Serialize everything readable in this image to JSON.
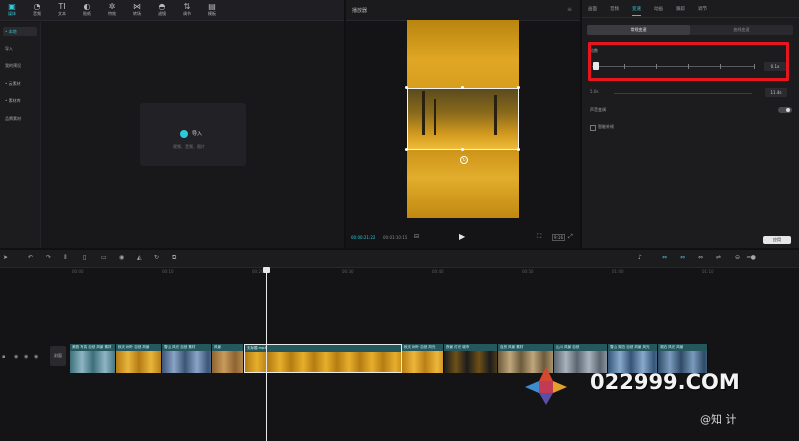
{
  "media_panel": {
    "toolbar": [
      {
        "label": "媒体",
        "icon": "media-icon",
        "glyph": "▣"
      },
      {
        "label": "音频",
        "icon": "audio-icon",
        "glyph": "◔"
      },
      {
        "label": "文本",
        "icon": "text-icon",
        "glyph": "TI"
      },
      {
        "label": "贴纸",
        "icon": "sticker-icon",
        "glyph": "◐"
      },
      {
        "label": "特效",
        "icon": "effects-icon",
        "glyph": "✲"
      },
      {
        "label": "转场",
        "icon": "transition-icon",
        "glyph": "⋈"
      },
      {
        "label": "滤镜",
        "icon": "filter-icon",
        "glyph": "◓"
      },
      {
        "label": "调节",
        "icon": "adjust-icon",
        "glyph": "⇅"
      },
      {
        "label": "模板",
        "icon": "template-icon",
        "glyph": "▤"
      }
    ],
    "side_nav": [
      "• 本地",
      "导入",
      "我的预设",
      "• 云素材",
      "• 素材库",
      "品牌素材"
    ],
    "import_label": "导入",
    "import_sub": "视频、音频、图片"
  },
  "player": {
    "title": "播放器",
    "current_time": "00:00:21:22",
    "total_time": "00:01:10:15",
    "ratio": "9:16"
  },
  "right_panel": {
    "tabs": [
      "画面",
      "音频",
      "变速",
      "动画",
      "跟踪",
      "调节"
    ],
    "active_tab": 2,
    "segments": [
      "常规变速",
      "曲线变速"
    ],
    "speed_label": "倍数",
    "speed_value": "0.1x",
    "duration_from": "5.0s",
    "duration_to": "11.4s",
    "pitch_label": "声音变调",
    "smooth_label": "智能补帧",
    "apply_label": "应用"
  },
  "timeline": {
    "ruler": [
      "00:00",
      "00:10",
      "00:20",
      "00:30",
      "00:40",
      "00:50",
      "01:00",
      "01:10"
    ],
    "cover_label": "封面",
    "clips": [
      {
        "name": "美丽 写真 自然 风景 素材",
        "colors": [
          "#3d6f7a",
          "#8fb5c4"
        ],
        "width": 46
      },
      {
        "name": "秋天 树叶 自然 风景",
        "colors": [
          "#b47a15",
          "#e8b53b"
        ],
        "width": 46
      },
      {
        "name": "雪山 风光 自然 素材",
        "colors": [
          "#3b5577",
          "#8aa3c6"
        ],
        "width": 50
      },
      {
        "name": "风景",
        "colors": [
          "#8d6430",
          "#c89a5b"
        ],
        "width": 32
      },
      {
        "name": "无标题.mp4",
        "colors": [
          "#b47c12",
          "#e7ae2b"
        ],
        "width": 158
      },
      {
        "name": "秋天 树叶 自然 风光",
        "colors": [
          "#b98016",
          "#ecb63a"
        ],
        "width": 42
      },
      {
        "name": "夜景 灯光 城市",
        "colors": [
          "#1c1c1c",
          "#6e5018"
        ],
        "width": 54
      },
      {
        "name": "自然 风景 素材",
        "colors": [
          "#6c5a3c",
          "#bfa77c"
        ],
        "width": 56
      },
      {
        "name": "山川 风景 自然",
        "colors": [
          "#5b6570",
          "#a9b3bd"
        ],
        "width": 54
      },
      {
        "name": "雪山 湖泊 自然 风景 风光",
        "colors": [
          "#355477",
          "#89a9cc"
        ],
        "width": 50
      },
      {
        "name": "湖泊 风光 风景",
        "colors": [
          "#2e4a66",
          "#7c9bbd"
        ],
        "width": 50
      }
    ]
  },
  "watermark": {
    "site": "022999.COM",
    "zhihu": "@知 计"
  },
  "colors": {
    "accent": "#32c7d6",
    "highlight": "#e8141e",
    "clip_bar": "#24585d"
  }
}
